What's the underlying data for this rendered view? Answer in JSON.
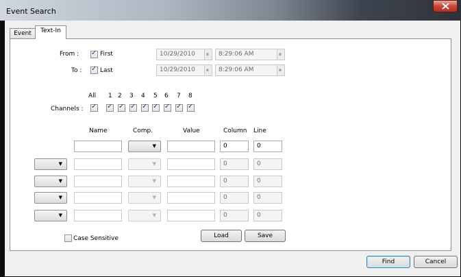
{
  "window": {
    "title": "Event Search"
  },
  "tabs": [
    {
      "label": "Event"
    },
    {
      "label": "Text-In",
      "active": true
    }
  ],
  "range": {
    "from": {
      "label": "From :",
      "check_label": "First",
      "checked": true,
      "date": "10/29/2010",
      "time": "8:29:06 AM"
    },
    "to": {
      "label": "To :",
      "check_label": "Last",
      "checked": true,
      "date": "10/29/2010",
      "time": "8:29:06 AM"
    }
  },
  "channels": {
    "label": "Channels :",
    "headers": [
      "All",
      "1",
      "2",
      "3",
      "4",
      "5",
      "6",
      "7",
      "8"
    ],
    "checked": [
      true,
      true,
      true,
      true,
      true,
      true,
      true,
      true,
      true
    ]
  },
  "conditions": {
    "columns": {
      "name": "Name",
      "comp": "Comp.",
      "value": "Value",
      "column": "Column",
      "line": "Line"
    },
    "rows": [
      {
        "name": "",
        "value": "",
        "column": "0",
        "line": "0",
        "enabled": true
      },
      {
        "name": "",
        "value": "",
        "column": "0",
        "line": "0",
        "enabled": false
      },
      {
        "name": "",
        "value": "",
        "column": "0",
        "line": "0",
        "enabled": false
      },
      {
        "name": "",
        "value": "",
        "column": "0",
        "line": "0",
        "enabled": false
      },
      {
        "name": "",
        "value": "",
        "column": "0",
        "line": "0",
        "enabled": false
      }
    ]
  },
  "case_sensitive": {
    "label": "Case Sensitive",
    "checked": false
  },
  "buttons": {
    "load": "Load",
    "save": "Save",
    "find": "Find",
    "cancel": "Cancel"
  },
  "colors": {
    "accent": "#3c7fb1",
    "close": "#c8463a"
  },
  "icons": {
    "close": "close-icon",
    "dropdown": "chevron-down-icon",
    "spinner": "spinner-arrows-icon"
  }
}
